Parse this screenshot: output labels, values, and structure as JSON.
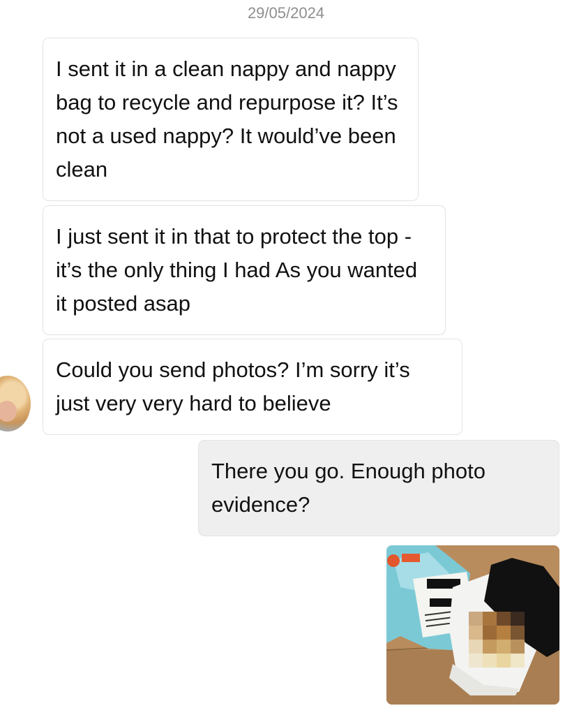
{
  "thread": {
    "date_separator": "29/05/2024"
  },
  "messages": [
    {
      "direction": "incoming",
      "text": "I sent it in a clean nappy and nappy bag to recycle and repurpose it? It’s not a used nappy? It would’ve been clean"
    },
    {
      "direction": "incoming",
      "text": "I just sent it in that to protect the top - it’s the only thing I had As you wanted it posted asap"
    },
    {
      "direction": "incoming",
      "text": "Could you send photos? I’m sorry it’s just very very hard to believe"
    },
    {
      "direction": "outgoing",
      "text": "There you go. Enough photo evidence?"
    }
  ],
  "attachment": {
    "type": "photo",
    "redacted": true
  },
  "colors": {
    "incoming_bubble": "#ffffff",
    "outgoing_bubble": "#efefef",
    "bubble_border": "#e3e3e3",
    "date_text": "#8e8e8e"
  }
}
